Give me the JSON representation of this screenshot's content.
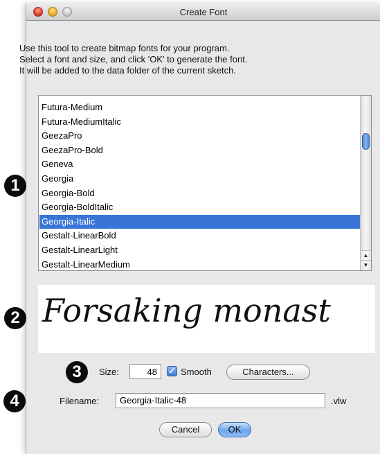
{
  "window": {
    "title": "Create Font"
  },
  "instructions": [
    "Use this tool to create bitmap fonts for your program.",
    "Select a font and size, and click 'OK' to generate the font.",
    "It will be added to the data folder of the current sketch."
  ],
  "font_list": {
    "items": [
      "Futura-Medium",
      "Futura-MediumItalic",
      "GeezaPro",
      "GeezaPro-Bold",
      "Geneva",
      "Georgia",
      "Georgia-Bold",
      "Georgia-BoldItalic",
      "Georgia-Italic",
      "Gestalt-LinearBold",
      "Gestalt-LinearLight",
      "Gestalt-LinearMedium"
    ],
    "selected": "Georgia-Italic"
  },
  "preview": {
    "text": "Forsaking monast"
  },
  "controls": {
    "size_label": "Size:",
    "size_value": "48",
    "smooth_label": "Smooth",
    "smooth_checked": true,
    "characters_button": "Characters...",
    "filename_label": "Filename:",
    "filename_value": "Georgia-Italic-48",
    "extension": ".vlw",
    "cancel_button": "Cancel",
    "ok_button": "OK"
  },
  "callouts": [
    "1",
    "2",
    "3",
    "4"
  ],
  "colors": {
    "selection": "#3875d7",
    "ok_button": "#6ea6eb",
    "window_bg": "#e8e8e8"
  }
}
